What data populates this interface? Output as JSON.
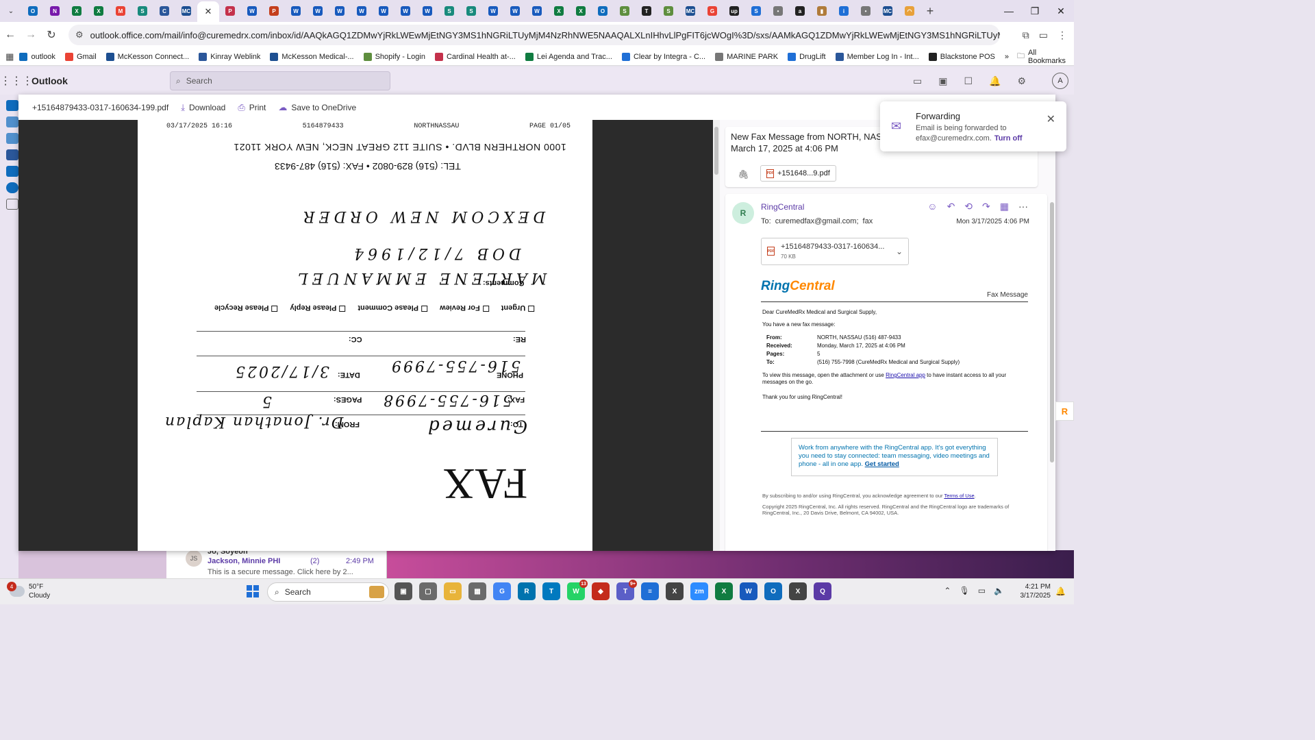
{
  "browser": {
    "tabs": [
      {
        "label": "O",
        "color": "#0f6cbd"
      },
      {
        "label": "N",
        "color": "#7719aa"
      },
      {
        "label": "X",
        "color": "#107c41"
      },
      {
        "label": "X",
        "color": "#107c41"
      },
      {
        "label": "M",
        "color": "#ea4335"
      },
      {
        "label": "S",
        "color": "#188a7c"
      },
      {
        "label": "C",
        "color": "#2b579a"
      },
      {
        "label": "MC",
        "color": "#1d4f91"
      },
      {
        "label": "active",
        "color": "#ffffff"
      },
      {
        "label": "P",
        "color": "#c4314b"
      },
      {
        "label": "W",
        "color": "#185abd"
      },
      {
        "label": "P",
        "color": "#c43e1c"
      },
      {
        "label": "W",
        "color": "#185abd"
      },
      {
        "label": "W",
        "color": "#185abd"
      },
      {
        "label": "W",
        "color": "#185abd"
      },
      {
        "label": "W",
        "color": "#185abd"
      },
      {
        "label": "W",
        "color": "#185abd"
      },
      {
        "label": "W",
        "color": "#185abd"
      },
      {
        "label": "W",
        "color": "#185abd"
      },
      {
        "label": "S",
        "color": "#188a7c"
      },
      {
        "label": "S",
        "color": "#188a7c"
      },
      {
        "label": "W",
        "color": "#185abd"
      },
      {
        "label": "W",
        "color": "#185abd"
      },
      {
        "label": "W",
        "color": "#185abd"
      },
      {
        "label": "X",
        "color": "#107c41"
      },
      {
        "label": "X",
        "color": "#107c41"
      },
      {
        "label": "O",
        "color": "#0f6cbd"
      },
      {
        "label": "S",
        "color": "#5e8e3e"
      },
      {
        "label": "T",
        "color": "#222222"
      },
      {
        "label": "S",
        "color": "#5e8e3e"
      },
      {
        "label": "MC",
        "color": "#1d4f91"
      },
      {
        "label": "G",
        "color": "#ea4335"
      },
      {
        "label": "up",
        "color": "#222222"
      },
      {
        "label": "S",
        "color": "#1f6fd6"
      },
      {
        "label": "•",
        "color": "#777777"
      },
      {
        "label": "a",
        "color": "#222222"
      },
      {
        "label": "▮",
        "color": "#b07b3a"
      },
      {
        "label": "i",
        "color": "#1f6fd6"
      },
      {
        "label": "•",
        "color": "#777777"
      },
      {
        "label": "MC",
        "color": "#1d4f91"
      },
      {
        "label": "◠",
        "color": "#e8a13a"
      }
    ],
    "url": "outlook.office.com/mail/info@curemedrx.com/inbox/id/AAQkAGQ1ZDMwYjRkLWEwMjEtNGY3MS1hNGRiLTUyMjM4NzRhNWE5NAAQALXLnIHhvLlPgFIT6jcWOgI%3D/sxs/AAMkAGQ1ZDMwYjRkLWEwMjEtNGY3MS1hNGRiLTUyMjM4NzRhNWE5N...",
    "bookmarks": [
      {
        "label": "outlook",
        "color": "#0f6cbd"
      },
      {
        "label": "Gmail",
        "color": "#ea4335"
      },
      {
        "label": "McKesson Connect...",
        "color": "#1d4f91"
      },
      {
        "label": "Kinray Weblink",
        "color": "#2b579a"
      },
      {
        "label": "McKesson Medical-...",
        "color": "#1d4f91"
      },
      {
        "label": "Shopify - Login",
        "color": "#5e8e3e"
      },
      {
        "label": "Cardinal Health at-...",
        "color": "#c4314b"
      },
      {
        "label": "Lei Agenda and Trac...",
        "color": "#107c41"
      },
      {
        "label": "Clear by Integra - C...",
        "color": "#1f6fd6"
      },
      {
        "label": "MARINE PARK",
        "color": "#777777"
      },
      {
        "label": "DrugLift",
        "color": "#1f6fd6"
      },
      {
        "label": "Member Log In - Int...",
        "color": "#2b579a"
      },
      {
        "label": "Blackstone POS",
        "color": "#222222"
      }
    ],
    "all_bookmarks": "All Bookmarks"
  },
  "outlook": {
    "app_name": "Outlook",
    "search_placeholder": "Search",
    "avatar": "A"
  },
  "viewer": {
    "file_name": "+15164879433-0317-160634-199.pdf",
    "download": "Download",
    "print": "Print",
    "save_onedrive": "Save to OneDrive"
  },
  "fax_page": {
    "header_date": "03/17/2025  16:16",
    "header_number": "5164879433",
    "header_station": "NORTHNASSAU",
    "header_page": "PAGE  01/05",
    "address": "1000 NORTHERN BLVD. • SUITE 112  GREAT NECK, NEW YORK 11021",
    "phone_line": "TEL: (516) 829-0802 • FAX: (516) 487-9433",
    "note_title": "DEXCOM NEW ORDER",
    "note_dob": "DOB 7/12/1964",
    "note_patient": "MARLENE EMMANUEL",
    "comments_label": "Comments:",
    "checkboxes": [
      "Urgent",
      "For Review",
      "Please Comment",
      "Please Reply",
      "Please Recycle"
    ],
    "re_label": "RE:",
    "cc_label": "CC:",
    "phone_label": "PHONE",
    "phone_value": "516-755-7999",
    "date_label": "DATE:",
    "date_value": "3/17/2025",
    "fax_label": "FAX:",
    "fax_value": "516-755-7998",
    "pages_label": "PAGES:",
    "pages_value": "5",
    "to_label": "TO:",
    "to_value": "Curemed",
    "from_label": "FROM:",
    "from_value": "Dr. Jonathan Kaplan",
    "big_title": "FAX"
  },
  "reading": {
    "subject": "New Fax Message from NORTH, NASSAU (516) 487-9433 on Monday, March 17, 2025 at 4:06 PM",
    "subject_attachment": "+151648...9.pdf",
    "sender": "RingCentral",
    "sender_initial": "R",
    "to_label": "To:",
    "to_address": "curemedfax@gmail.com;",
    "to_extra": "fax",
    "date": "Mon 3/17/2025 4:06 PM",
    "attachment_name": "+15164879433-0317-160634...",
    "attachment_size": "70 KB",
    "logo_ring": "Ring",
    "logo_central": "Central",
    "fax_message": "Fax Message",
    "greeting": "Dear CureMedRx Medical and Surgical Supply,",
    "intro": "You have a new fax message:",
    "rows": [
      {
        "k": "From:",
        "v": "NORTH, NASSAU (516) 487-9433"
      },
      {
        "k": "Received:",
        "v": "Monday, March 17, 2025 at 4:06 PM"
      },
      {
        "k": "Pages:",
        "v": "5"
      },
      {
        "k": "To:",
        "v": "(516) 755-7998 (CureMedRx Medical and Surgical Supply)"
      }
    ],
    "view_pre": "To view this message, open the attachment or use ",
    "view_link": "RingCentral app",
    "view_post": " to have instant access to all your messages on the go.",
    "thanks": "Thank you for using RingCentral!",
    "promo": "Work from anywhere with the RingCentral app. It's got everything you need to stay connected: team messaging, video meetings and phone - all in one app.",
    "promo_link": "Get started",
    "legal_pre": "By subscribing to and/or using RingCentral, you acknowledge agreement to our ",
    "legal_link": "Terms of Use",
    "legal_post": ".",
    "copyright": "Copyright 2025 RingCentral, Inc. All rights reserved. RingCentral and the RingCentral logo are trademarks of RingCentral, Inc., 20 Davis Drive, Belmont, CA 94002, USA."
  },
  "toast": {
    "title": "Forwarding",
    "body": "Email is being forwarded to efax@curemedrx.com.",
    "action": "Turn off"
  },
  "background_list": {
    "initials": "JS",
    "row1": "Jo, Soyeon",
    "sender": "Jackson, Minnie PHI",
    "count": "(2)",
    "time": "2:49 PM",
    "preview": "This is a secure message. Click here by 2..."
  },
  "taskbar": {
    "weather_badge": "4",
    "temperature": "50°F",
    "condition": "Cloudy",
    "search": "Search",
    "apps": [
      {
        "label": "▣",
        "color": "#555555",
        "badge": ""
      },
      {
        "label": "▢",
        "color": "#6b6b6b",
        "badge": ""
      },
      {
        "label": "▭",
        "color": "#e8b43a",
        "badge": ""
      },
      {
        "label": "▦",
        "color": "#6b6b6b",
        "badge": ""
      },
      {
        "label": "G",
        "color": "#4285f4",
        "badge": ""
      },
      {
        "label": "R",
        "color": "#0073ae",
        "badge": ""
      },
      {
        "label": "T",
        "color": "#0079bf",
        "badge": ""
      },
      {
        "label": "W",
        "color": "#25d366",
        "badge": "13"
      },
      {
        "label": "◆",
        "color": "#c42b1c",
        "badge": ""
      },
      {
        "label": "T",
        "color": "#5b5fc7",
        "badge": "9+"
      },
      {
        "label": "≡",
        "color": "#1f6fd6",
        "badge": ""
      },
      {
        "label": "X",
        "color": "#444444",
        "badge": ""
      },
      {
        "label": "zm",
        "color": "#2d8cff",
        "badge": ""
      },
      {
        "label": "X",
        "color": "#107c41",
        "badge": ""
      },
      {
        "label": "W",
        "color": "#185abd",
        "badge": ""
      },
      {
        "label": "O",
        "color": "#0f6cbd",
        "badge": ""
      },
      {
        "label": "X",
        "color": "#444444",
        "badge": ""
      },
      {
        "label": "Q",
        "color": "#5b3aa6",
        "badge": ""
      }
    ],
    "time": "4:21 PM",
    "date": "3/17/2025"
  }
}
